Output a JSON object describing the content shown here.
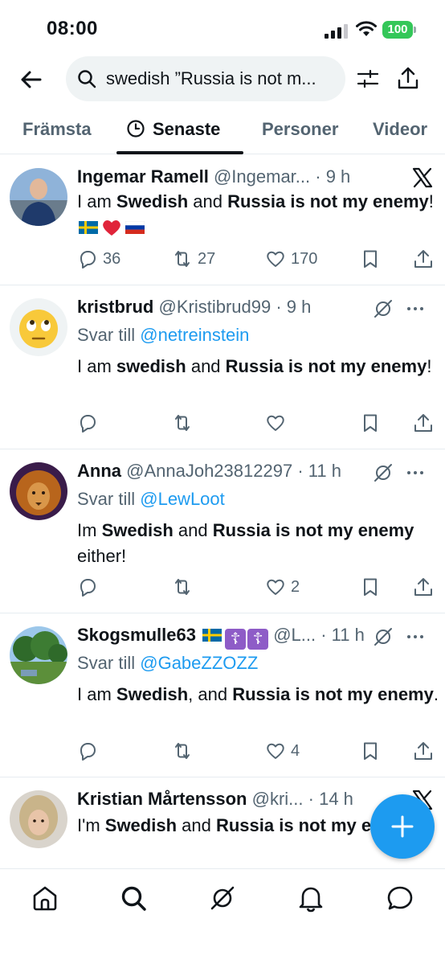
{
  "status": {
    "time": "08:00",
    "battery": "100"
  },
  "search": {
    "query": "swedish ”Russia is not m..."
  },
  "tabs": [
    {
      "label": "Främsta"
    },
    {
      "label": "Senaste"
    },
    {
      "label": "Personer"
    },
    {
      "label": "Videor"
    }
  ],
  "tweets": [
    {
      "name": "Ingemar Ramell",
      "handle": "@Ingemar...",
      "time": "· 9 h",
      "reply_prefix": "",
      "reply_to": "",
      "text_parts": [
        "I am ",
        "Swedish",
        " and ",
        "Russia is not my enemy",
        "! "
      ],
      "emoji": "🇸🇪❤️🇷🇺",
      "replies": "36",
      "retweets": "27",
      "likes": "170"
    },
    {
      "name": "kristbrud",
      "handle": "@Kristibrud99",
      "time": "· 9 h",
      "reply_prefix": "Svar till ",
      "reply_to": "@netreinstein",
      "text_parts": [
        "I am ",
        "swedish",
        " and ",
        "Russia is not my enemy",
        "!"
      ],
      "replies": "",
      "retweets": "",
      "likes": ""
    },
    {
      "name": "Anna",
      "handle": "@AnnaJoh23812297",
      "time": "· 11 h",
      "reply_prefix": "Svar till ",
      "reply_to": "@LewLoot",
      "text_parts": [
        "Im ",
        "Swedish",
        " and ",
        "Russia is not my enemy",
        " either!"
      ],
      "replies": "",
      "retweets": "",
      "likes": "2"
    },
    {
      "name": "Skogsmulle63",
      "handle": "@L...",
      "time": "· 11 h",
      "reply_prefix": "Svar till ",
      "reply_to": "@GabeZZOZZ",
      "text_parts": [
        "I am ",
        "Swedish",
        ", and ",
        "Russia is not my enemy",
        "."
      ],
      "replies": "",
      "retweets": "",
      "likes": "4"
    },
    {
      "name": "Kristian Mårtensson",
      "handle": "@kri...",
      "time": "· 14 h",
      "reply_prefix": "",
      "reply_to": "",
      "text_parts": [
        "I'm ",
        "Swedish",
        " and ",
        "Russia is not my enemy",
        "."
      ]
    }
  ],
  "colors": {
    "accent": "#1d9bf0",
    "text": "#0f1419",
    "muted": "#536471",
    "battery": "#34c759"
  },
  "icons": {
    "back": "arrow-left-icon",
    "search": "search-icon",
    "filter": "sliders-icon",
    "share": "share-icon",
    "more": "more-icon",
    "grok": "grok-icon",
    "x": "x-logo-icon",
    "compose": "plus-icon"
  }
}
